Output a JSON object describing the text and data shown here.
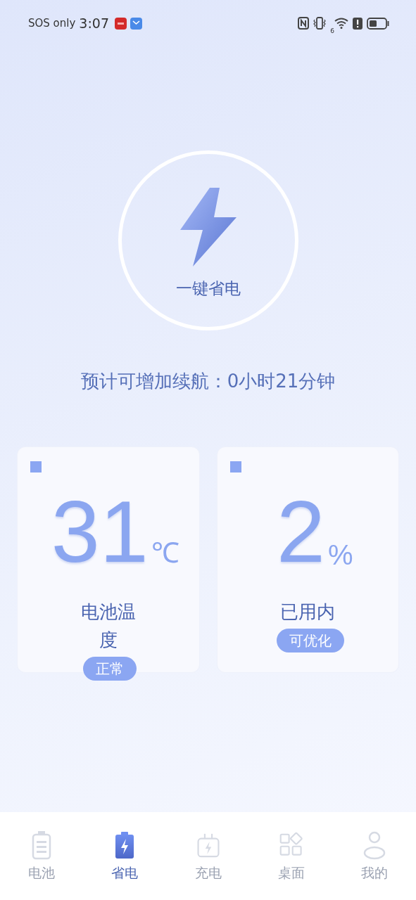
{
  "status_bar": {
    "carrier": "SOS only",
    "time": "3:07",
    "network_label": "6"
  },
  "boost_button": {
    "label": "一键省电"
  },
  "estimate": "预计可增加续航：0小时21分钟",
  "cards": [
    {
      "value": "31",
      "unit": "℃",
      "label": "电池温度",
      "badge": "正常"
    },
    {
      "value": "2",
      "unit": "%",
      "label": "已用内",
      "badge": "可优化"
    }
  ],
  "nav": [
    {
      "label": "电池",
      "selected": false
    },
    {
      "label": "省电",
      "selected": true
    },
    {
      "label": "充电",
      "selected": false
    },
    {
      "label": "桌面",
      "selected": false
    },
    {
      "label": "我的",
      "selected": false
    }
  ]
}
